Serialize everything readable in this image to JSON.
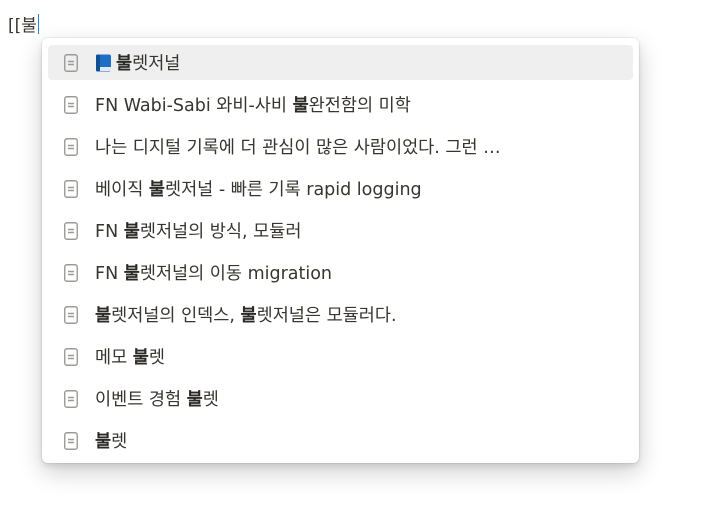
{
  "editor": {
    "typed_text": "[[불"
  },
  "popup": {
    "items": [
      {
        "icon": "page-icon",
        "prefix_emoji": "blue-book",
        "segments": [
          {
            "text": "불",
            "bold": true
          },
          {
            "text": "렛저널",
            "bold": false
          }
        ],
        "selected": true
      },
      {
        "icon": "page-icon",
        "segments": [
          {
            "text": "FN Wabi-Sabi 와비-사비 ",
            "bold": false
          },
          {
            "text": "불",
            "bold": true
          },
          {
            "text": "완전함의 미학",
            "bold": false
          }
        ],
        "selected": false
      },
      {
        "icon": "page-icon",
        "segments": [
          {
            "text": "나는 디지털 기록에 더 관심이 많은 사람이었다. 그런 …",
            "bold": false
          }
        ],
        "selected": false
      },
      {
        "icon": "page-icon",
        "segments": [
          {
            "text": "베이직 ",
            "bold": false
          },
          {
            "text": "불",
            "bold": true
          },
          {
            "text": "렛저널 - 빠른 기록 rapid logging",
            "bold": false
          }
        ],
        "selected": false
      },
      {
        "icon": "page-icon",
        "segments": [
          {
            "text": "FN ",
            "bold": false
          },
          {
            "text": "불",
            "bold": true
          },
          {
            "text": "렛저널의 방식, 모듈러",
            "bold": false
          }
        ],
        "selected": false
      },
      {
        "icon": "page-icon",
        "segments": [
          {
            "text": "FN ",
            "bold": false
          },
          {
            "text": "불",
            "bold": true
          },
          {
            "text": "렛저널의 이동 migration",
            "bold": false
          }
        ],
        "selected": false
      },
      {
        "icon": "page-icon",
        "segments": [
          {
            "text": "불",
            "bold": true
          },
          {
            "text": "렛저널의 인덱스, ",
            "bold": false
          },
          {
            "text": "불",
            "bold": true
          },
          {
            "text": "렛저널은 모듈러다.",
            "bold": false
          }
        ],
        "selected": false
      },
      {
        "icon": "page-icon",
        "segments": [
          {
            "text": "메모 ",
            "bold": false
          },
          {
            "text": "불",
            "bold": true
          },
          {
            "text": "렛",
            "bold": false
          }
        ],
        "selected": false
      },
      {
        "icon": "page-icon",
        "segments": [
          {
            "text": "이벤트 경험 ",
            "bold": false
          },
          {
            "text": "불",
            "bold": true
          },
          {
            "text": "렛",
            "bold": false
          }
        ],
        "selected": false
      },
      {
        "icon": "page-icon",
        "segments": [
          {
            "text": "불",
            "bold": true
          },
          {
            "text": "렛",
            "bold": false
          }
        ],
        "selected": false
      }
    ]
  },
  "colors": {
    "text": "#37352f",
    "caret": "#2a7fd8",
    "selected_bg": "#efefef",
    "icon": "#9b9a97"
  }
}
